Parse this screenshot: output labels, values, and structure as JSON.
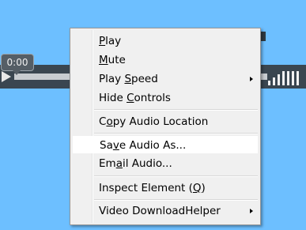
{
  "player": {
    "time": "0:00"
  },
  "menu": {
    "items": [
      {
        "label": "Play",
        "mnemonic_index": 0
      },
      {
        "label": "Mute",
        "mnemonic_index": 0
      },
      {
        "label": "Play Speed",
        "mnemonic_index": 5,
        "submenu": true
      },
      {
        "label": "Hide Controls",
        "mnemonic_index": 5
      },
      {
        "label": "Copy Audio Location",
        "mnemonic_index": 1
      },
      {
        "label": "Save Audio As...",
        "mnemonic_index": 2
      },
      {
        "label": "Email Audio...",
        "mnemonic_index": 2
      },
      {
        "label": "Inspect Element (Q)",
        "mnemonic_index": 17
      },
      {
        "label": "Video DownloadHelper",
        "submenu": true
      }
    ]
  }
}
